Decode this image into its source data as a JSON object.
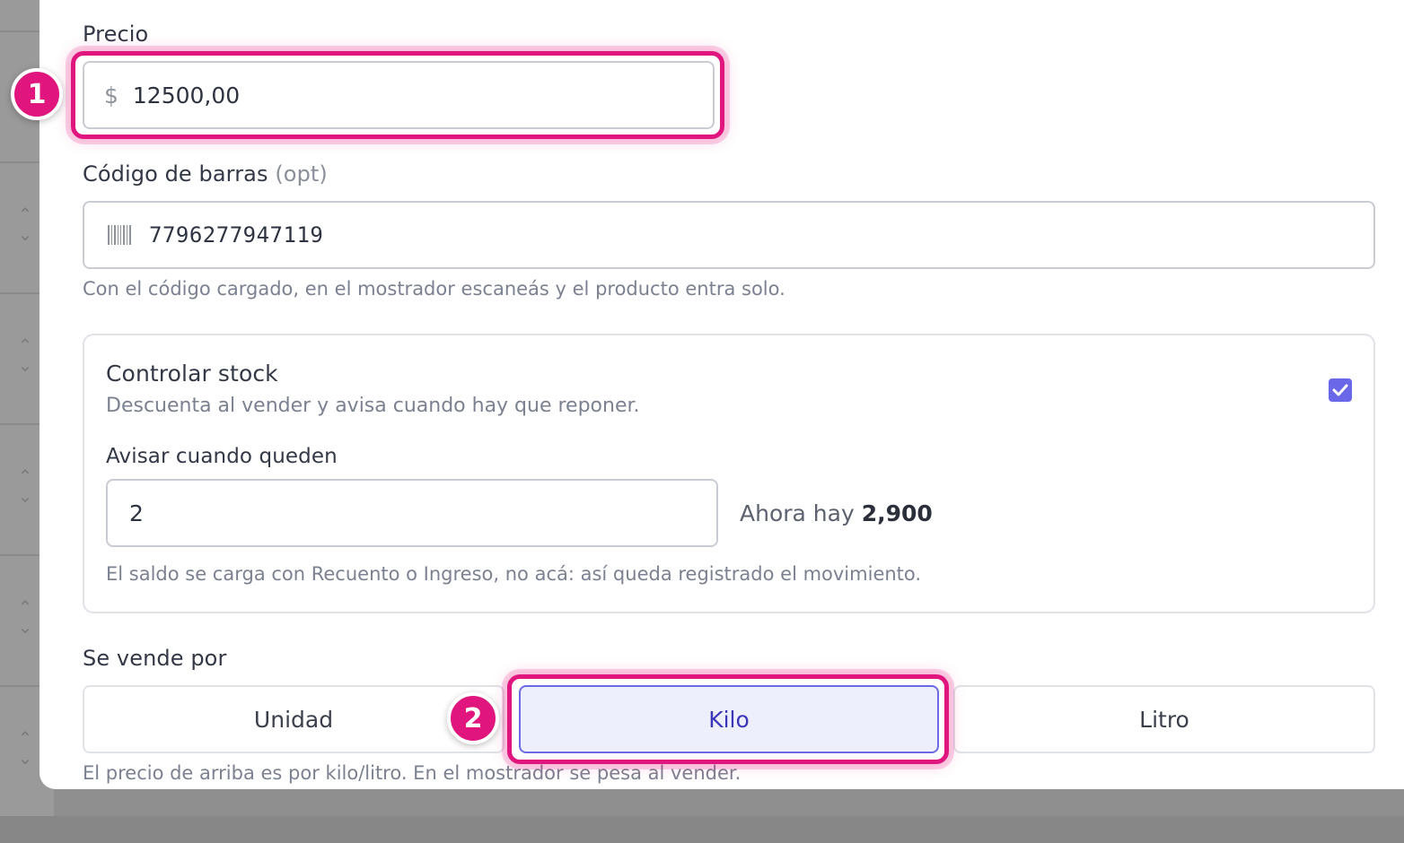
{
  "background": {
    "chevron_up": "⌃",
    "chevron_down": "⌄"
  },
  "price": {
    "label": "Precio",
    "currency_symbol": "$",
    "value": "12500,00"
  },
  "barcode": {
    "label": "Código de barras",
    "optional_tag": "(opt)",
    "icon": "barcode-icon",
    "value": "7796277947119",
    "help": "Con el código cargado, en el mostrador escaneás y el producto entra solo."
  },
  "stock": {
    "title": "Controlar stock",
    "description": "Descuenta al vender y avisa cuando hay que reponer.",
    "enabled": true,
    "alert_label": "Avisar cuando queden",
    "alert_value": "2",
    "current_prefix": "Ahora hay",
    "current_value": "2,900",
    "help": "El saldo se carga con Recuento o Ingreso, no acá: así queda registrado el movimiento."
  },
  "sold_by": {
    "label": "Se vende por",
    "options": [
      "Unidad",
      "Kilo",
      "Litro"
    ],
    "selected": "Kilo",
    "help": "El precio de arriba es por kilo/litro. En el mostrador se pesa al vender."
  },
  "annotations": {
    "badge_1": "1",
    "badge_2": "2",
    "highlight_color": "#e0157d"
  },
  "colors": {
    "accent": "#6a67e8",
    "highlight": "#e0157d"
  }
}
